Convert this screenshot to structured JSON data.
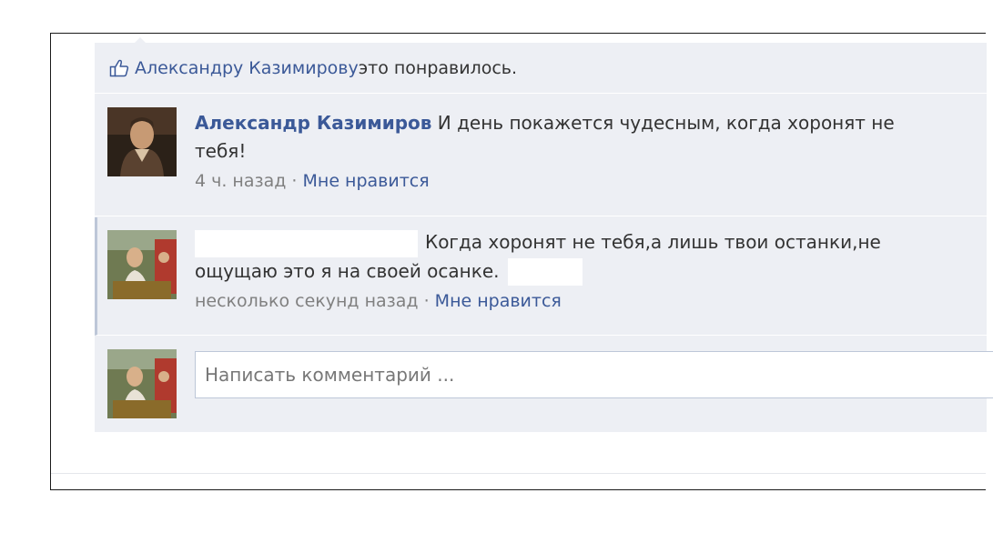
{
  "likes": {
    "liker_name": "Александру Казимирову",
    "suffix": " это понравилось."
  },
  "comments": [
    {
      "author": "Александр Казимиров",
      "text": " И день покажется чудесным, когда хоронят не тебя!",
      "time": "4 ч. назад",
      "separator": " · ",
      "like_label": "Мне нравится"
    },
    {
      "author": "",
      "text": "Когда хоронят не тебя,а лишь твои останки,не ощущаю это я на своей осанке.",
      "time": "несколько секунд назад",
      "separator": " · ",
      "like_label": "Мне нравится"
    }
  ],
  "composer": {
    "placeholder": "Написать комментарий ..."
  },
  "icons": {
    "like": "thumbs-up-icon"
  },
  "colors": {
    "link": "#3b5998",
    "feed_bg": "#edeff4",
    "meta": "#808080"
  }
}
